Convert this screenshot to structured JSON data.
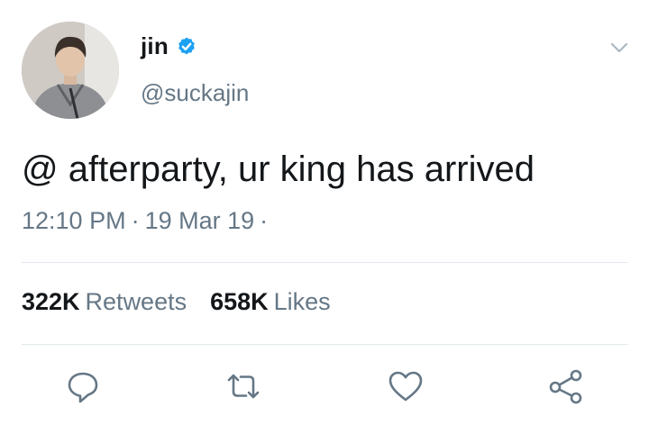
{
  "tweet": {
    "author": {
      "display_name": "jin",
      "handle": "@suckajin",
      "verified": true
    },
    "text": "@ afterparty, ur king has arrived",
    "time": "12:10 PM",
    "date": "19 Mar 19",
    "separator": "·",
    "stats": {
      "retweets_count": "322K",
      "retweets_label": "Retweets",
      "likes_count": "658K",
      "likes_label": "Likes"
    }
  },
  "icons": {
    "menu": "chevron-down-icon",
    "reply": "reply-icon",
    "retweet": "retweet-icon",
    "like": "heart-icon",
    "share": "share-icon"
  },
  "colors": {
    "verified_blue": "#1da1f2",
    "secondary_text": "#657786",
    "divider": "#e1e8ed",
    "icon_gray": "#657786"
  }
}
